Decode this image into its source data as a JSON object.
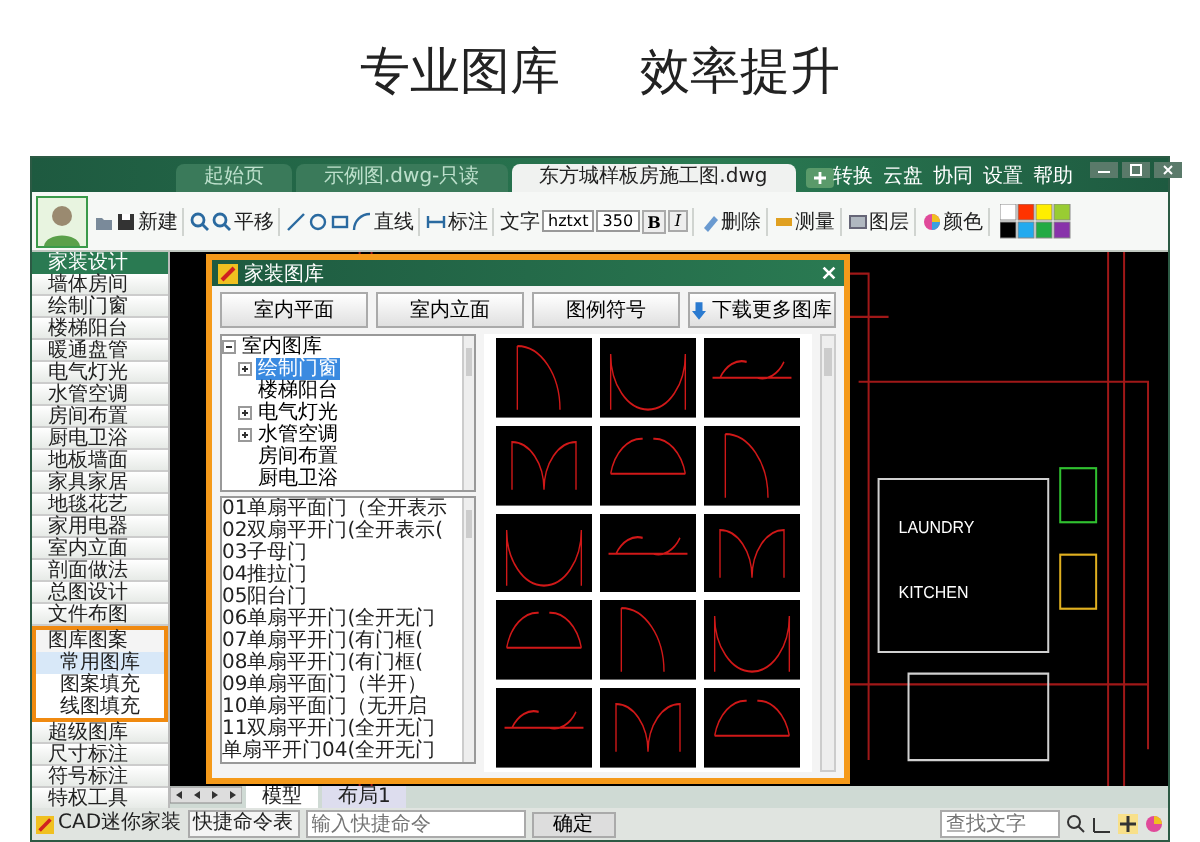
{
  "headline": [
    "专业图库",
    "效率提升"
  ],
  "tabs": [
    {
      "label": "起始页",
      "selected": false
    },
    {
      "label": "示例图.dwg-只读",
      "selected": false
    },
    {
      "label": "东方城样板房施工图.dwg",
      "selected": true
    }
  ],
  "top_menu": [
    "转换",
    "云盘",
    "协同",
    "设置",
    "帮助"
  ],
  "toolbar": {
    "labels": [
      "新建",
      "平移",
      "直线",
      "标注",
      "文字",
      "删除",
      "测量",
      "图层",
      "颜色"
    ],
    "font": "hztxt",
    "size": "350",
    "bold": "B",
    "italic": "I"
  },
  "sidebar": {
    "title": "家装设计",
    "items": [
      {
        "label": "墙体房间",
        "expanded": false
      },
      {
        "label": "绘制门窗",
        "expanded": false
      },
      {
        "label": "楼梯阳台",
        "expanded": false
      },
      {
        "label": "暖通盘管",
        "expanded": false
      },
      {
        "label": "电气灯光",
        "expanded": false
      },
      {
        "label": "水管空调",
        "expanded": false
      },
      {
        "label": "房间布置",
        "expanded": false
      },
      {
        "label": "厨电卫浴",
        "expanded": false
      },
      {
        "label": "地板墙面",
        "expanded": false
      },
      {
        "label": "家具家居",
        "expanded": false
      },
      {
        "label": "地毯花艺",
        "expanded": false
      },
      {
        "label": "家用电器",
        "expanded": false
      },
      {
        "label": "室内立面",
        "expanded": false
      },
      {
        "label": "剖面做法",
        "expanded": false
      },
      {
        "label": "总图设计",
        "expanded": false
      },
      {
        "label": "文件布图",
        "expanded": false
      },
      {
        "label": "图库图案",
        "expanded": true,
        "children": [
          {
            "label": "常用图库",
            "selected": true
          },
          {
            "label": "图案填充",
            "selected": false
          },
          {
            "label": "线图填充",
            "selected": false
          }
        ]
      },
      {
        "label": "超级图库",
        "expanded": false
      },
      {
        "label": "尺寸标注",
        "expanded": false
      },
      {
        "label": "符号标注",
        "expanded": false
      },
      {
        "label": "特权工具",
        "expanded": false
      }
    ]
  },
  "drawing_labels": [
    "LAUNDRY",
    "KITCHEN"
  ],
  "dialog": {
    "title": "家装图库",
    "buttons": [
      "室内平面",
      "室内立面",
      "图例符号",
      "下载更多图库"
    ],
    "tree": [
      {
        "label": "室内图库",
        "expanded": true,
        "selected": false,
        "children": [
          {
            "label": "绘制门窗",
            "expanded": false,
            "selected": true
          },
          {
            "label": "楼梯阳台",
            "selected": false
          },
          {
            "label": "电气灯光",
            "expanded": false,
            "selected": false
          },
          {
            "label": "水管空调",
            "expanded": false,
            "selected": false
          },
          {
            "label": "房间布置",
            "selected": false
          },
          {
            "label": "厨电卫浴",
            "selected": false
          }
        ]
      }
    ],
    "list": [
      "01单扇平面门（全开表示",
      "02双扇平开门(全开表示(",
      "03子母门",
      "04推拉门",
      "05阳台门",
      "06单扇平开门(全开无门",
      "07单扇平开门(有门框(",
      "08单扇平开门(有门框(",
      "09单扇平面门（半开）",
      "10单扇平面门（无开启",
      "11双扇平开门(全开无门",
      "单扇平开门04(全开无门"
    ]
  },
  "layout_tabs": [
    {
      "label": "模型",
      "selected": true
    },
    {
      "label": "布局1",
      "selected": false
    }
  ],
  "status_bar": {
    "app": "CAD迷你家装",
    "quick": "快捷命令表",
    "command_placeholder": "输入快捷命令",
    "ok": "确定",
    "search_placeholder": "查找文字"
  }
}
